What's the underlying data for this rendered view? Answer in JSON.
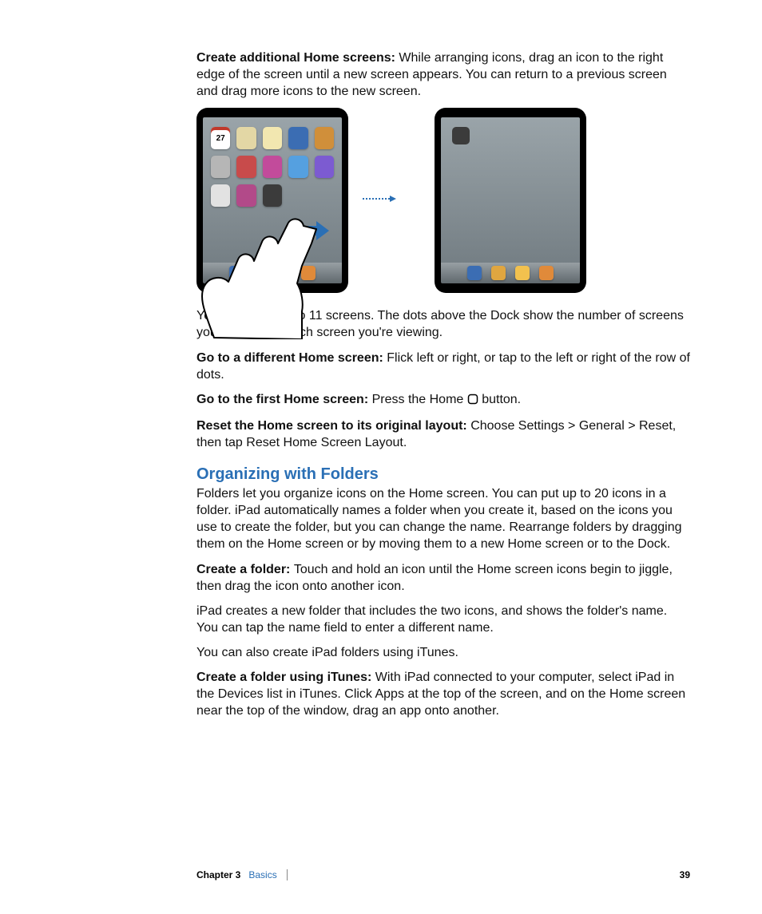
{
  "p1": {
    "lead": "Create additional Home screens:  ",
    "text": "While arranging icons, drag an icon to the right edge of the screen until a new screen appears. You can return to a previous screen and drag more icons to the new screen."
  },
  "figure": {
    "calendar_day": "27",
    "apps_row1": [
      "#f6f6f6",
      "#e3d7a5",
      "#f2e7b0",
      "#3b6db3",
      "#d08f3a"
    ],
    "apps_row2": [
      "#b6b6b6",
      "#c84b4b",
      "#c24b9b",
      "#55a0e0",
      "#7c5bd1"
    ],
    "apps_row3": [
      "#e2e2e2",
      "#b24a89",
      "#3b3b3b"
    ],
    "dock_apps": [
      "#3b6db3",
      "#e0a640",
      "#f2c14e",
      "#e08a3a"
    ]
  },
  "p2": "You can have up to 11 screens. The dots above the Dock show the number of screens you have, and which screen you're viewing.",
  "p3": {
    "lead": "Go to a different Home screen:  ",
    "text": "Flick left or right, or tap to the left or right of the row of dots."
  },
  "p4": {
    "lead": "Go to the first Home screen:  ",
    "pre": "Press the Home ",
    "post": " button."
  },
  "p5": {
    "lead": "Reset the Home screen to its original layout:  ",
    "text": "Choose Settings > General > Reset, then tap Reset Home Screen Layout."
  },
  "h2": "Organizing with Folders",
  "p6": "Folders let you organize icons on the Home screen. You can put up to 20 icons in a folder. iPad automatically names a folder when you create it, based on the icons you use to create the folder, but you can change the name. Rearrange folders by dragging them on the Home screen or by moving them to a new Home screen or to the Dock.",
  "p7": {
    "lead": "Create a folder:  ",
    "text": "Touch and hold an icon until the Home screen icons begin to jiggle, then drag the icon onto another icon."
  },
  "p8": "iPad creates a new folder that includes the two icons, and shows the folder's name. You can tap the name field to enter a different name.",
  "p9": "You can also create iPad folders using iTunes.",
  "p10": {
    "lead": "Create a folder using iTunes:  ",
    "text": "With iPad connected to your computer, select iPad in the Devices list in iTunes. Click Apps at the top of the screen, and on the Home screen near the top of the window, drag an app onto another."
  },
  "footer": {
    "chapter": "Chapter 3",
    "name": "Basics",
    "page": "39"
  }
}
